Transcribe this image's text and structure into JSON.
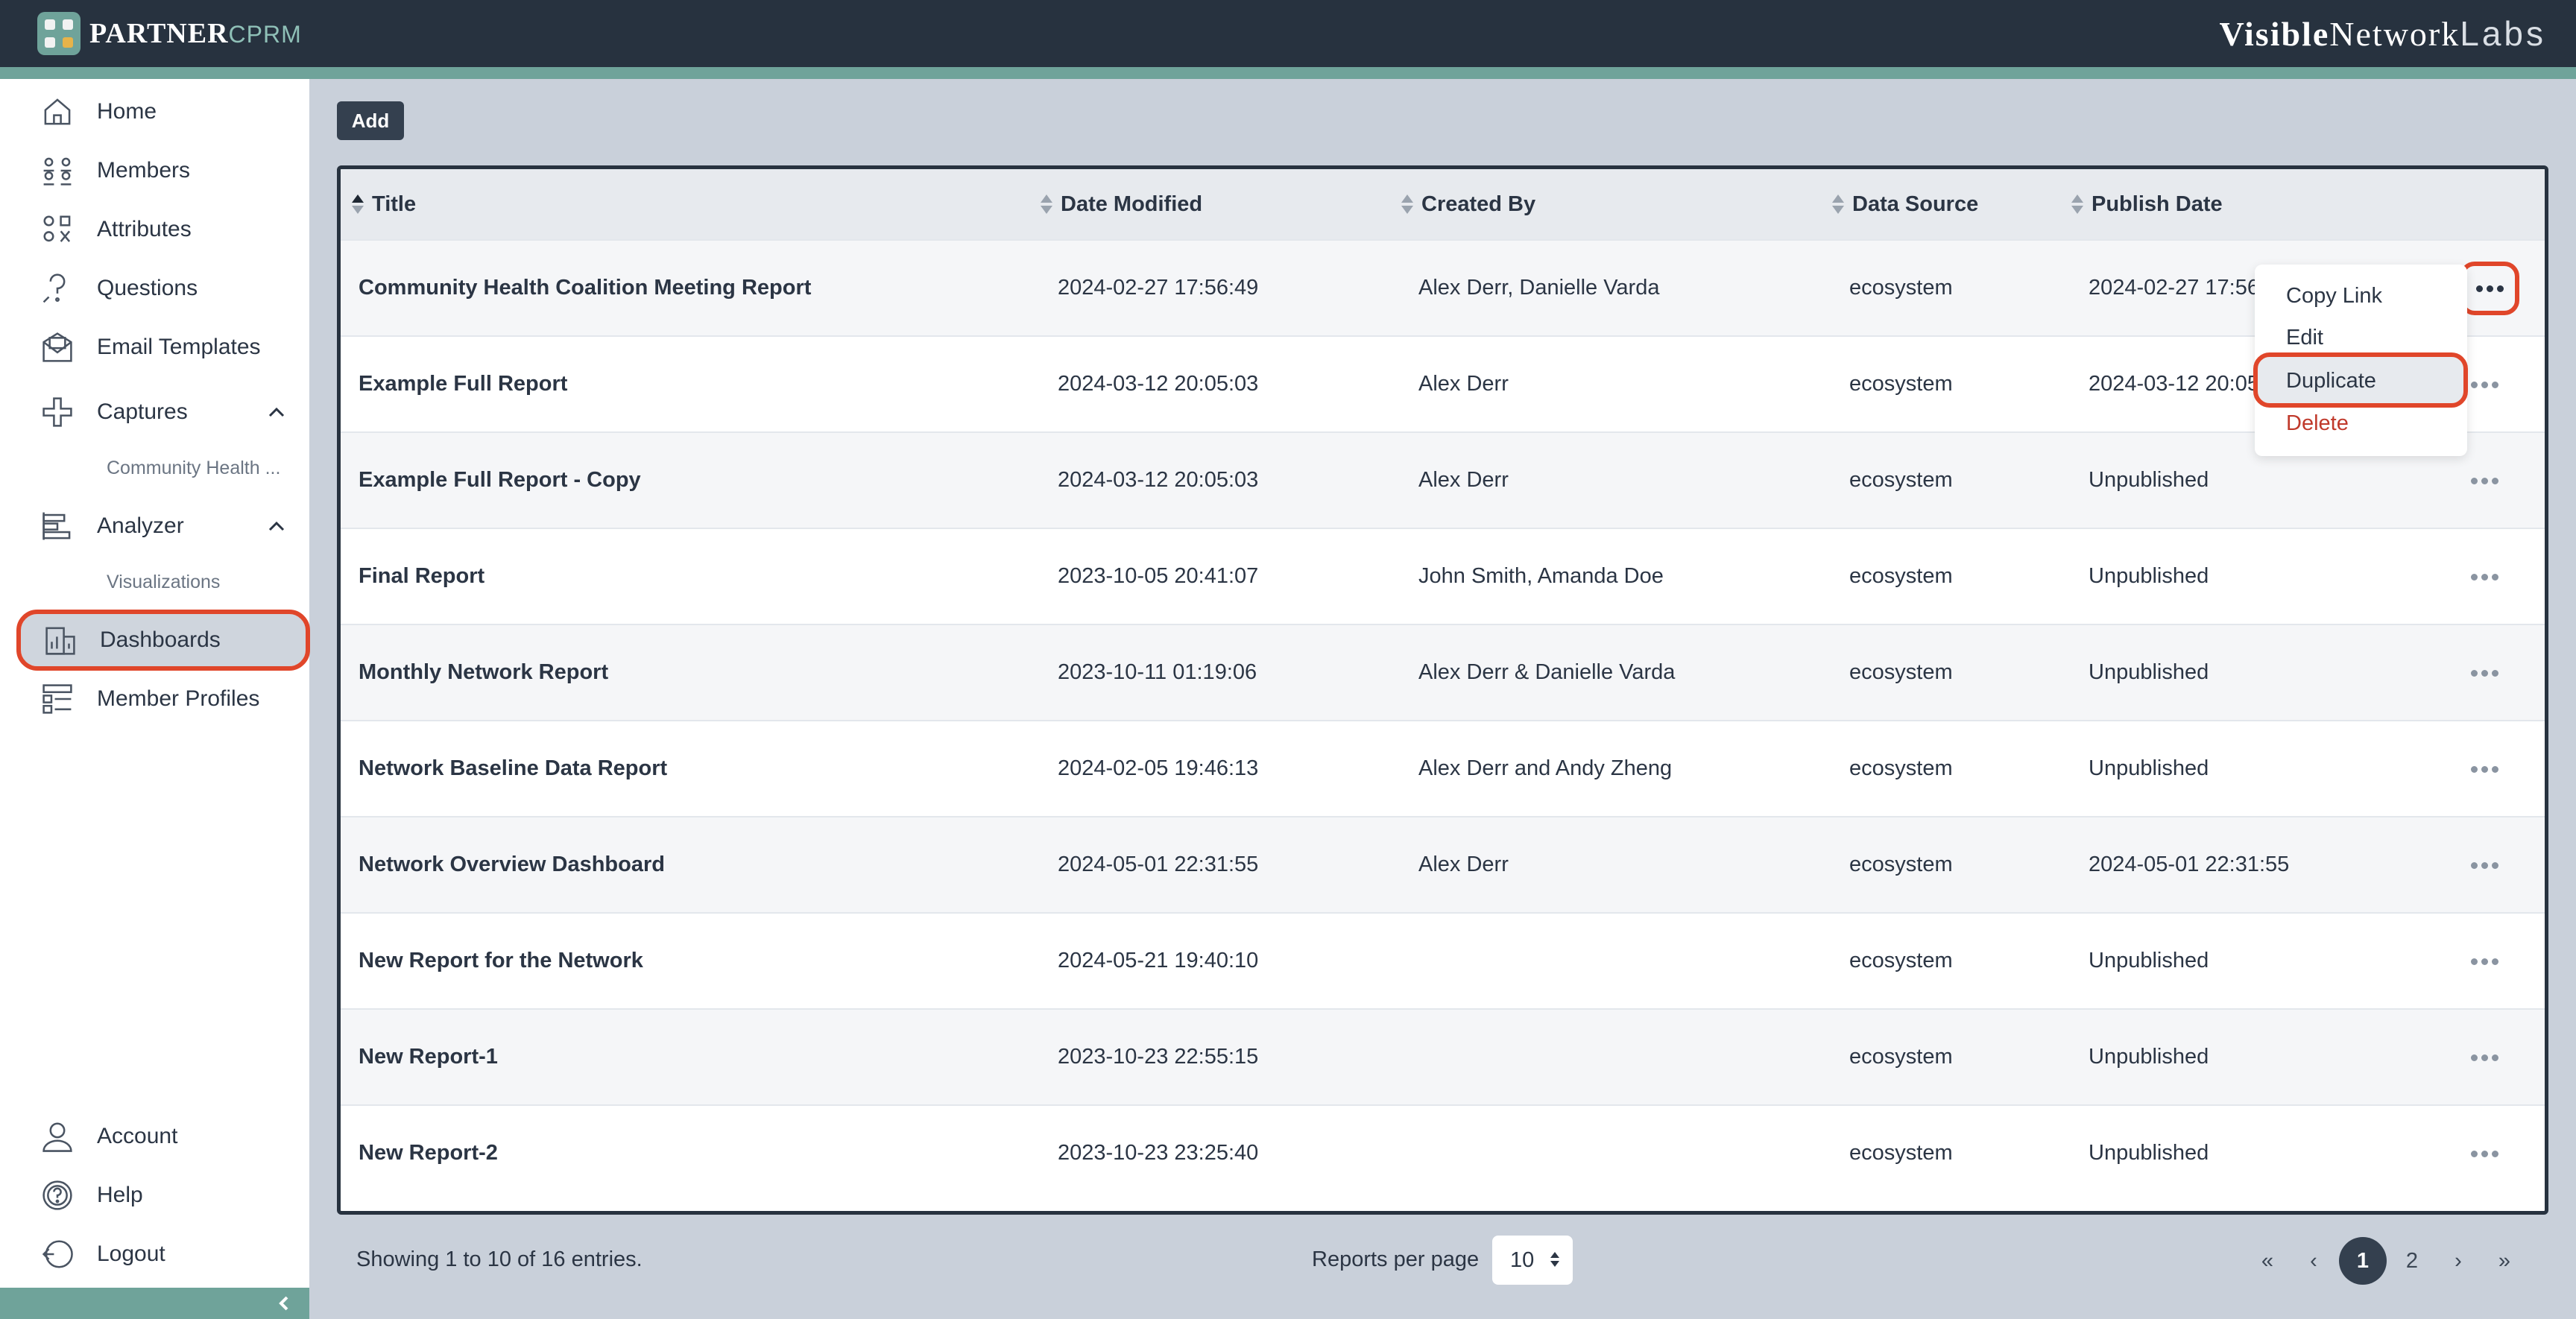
{
  "header": {
    "logo_primary": "PARTNER",
    "logo_secondary": "CPRM",
    "brand_part1": "Visible",
    "brand_part2": "Network",
    "brand_part3": "Labs"
  },
  "sidebar": {
    "items": [
      {
        "label": "Home",
        "icon": "home-icon"
      },
      {
        "label": "Members",
        "icon": "members-icon"
      },
      {
        "label": "Attributes",
        "icon": "attributes-icon"
      },
      {
        "label": "Questions",
        "icon": "questions-icon"
      },
      {
        "label": "Email Templates",
        "icon": "email-icon"
      },
      {
        "label": "Captures",
        "icon": "captures-icon"
      },
      {
        "label": "Analyzer",
        "icon": "analyzer-icon"
      },
      {
        "label": "Dashboards",
        "icon": "dashboards-icon"
      },
      {
        "label": "Member Profiles",
        "icon": "profiles-icon"
      }
    ],
    "captures_sub": "Community Health ...",
    "analyzer_sub": "Visualizations",
    "bottom": [
      {
        "label": "Account",
        "icon": "account-icon"
      },
      {
        "label": "Help",
        "icon": "help-icon"
      },
      {
        "label": "Logout",
        "icon": "logout-icon"
      }
    ]
  },
  "toolbar": {
    "add_label": "Add"
  },
  "table": {
    "columns": [
      "Title",
      "Date Modified",
      "Created By",
      "Data Source",
      "Publish Date"
    ],
    "rows": [
      {
        "title": "Community Health Coalition Meeting Report",
        "modified": "2024-02-27 17:56:49",
        "created_by": "Alex Derr, Danielle Varda",
        "source": "ecosystem",
        "publish": "2024-02-27 17:56"
      },
      {
        "title": "Example Full Report",
        "modified": "2024-03-12 20:05:03",
        "created_by": "Alex Derr",
        "source": "ecosystem",
        "publish": "2024-03-12 20:05"
      },
      {
        "title": "Example Full Report - Copy",
        "modified": "2024-03-12 20:05:03",
        "created_by": "Alex Derr",
        "source": "ecosystem",
        "publish": "Unpublished"
      },
      {
        "title": "Final Report",
        "modified": "2023-10-05 20:41:07",
        "created_by": "John Smith, Amanda Doe",
        "source": "ecosystem",
        "publish": "Unpublished"
      },
      {
        "title": "Monthly Network Report",
        "modified": "2023-10-11 01:19:06",
        "created_by": "Alex Derr & Danielle Varda",
        "source": "ecosystem",
        "publish": "Unpublished"
      },
      {
        "title": "Network Baseline Data Report",
        "modified": "2024-02-05 19:46:13",
        "created_by": "Alex Derr and Andy Zheng",
        "source": "ecosystem",
        "publish": "Unpublished"
      },
      {
        "title": "Network Overview Dashboard",
        "modified": "2024-05-01 22:31:55",
        "created_by": "Alex Derr",
        "source": "ecosystem",
        "publish": "2024-05-01 22:31:55"
      },
      {
        "title": "New Report for the Network",
        "modified": "2024-05-21 19:40:10",
        "created_by": "",
        "source": "ecosystem",
        "publish": "Unpublished"
      },
      {
        "title": "New Report-1",
        "modified": "2023-10-23 22:55:15",
        "created_by": "",
        "source": "ecosystem",
        "publish": "Unpublished"
      },
      {
        "title": "New Report-2",
        "modified": "2023-10-23 23:25:40",
        "created_by": "",
        "source": "ecosystem",
        "publish": "Unpublished"
      }
    ]
  },
  "menu": {
    "copy_link": "Copy Link",
    "edit": "Edit",
    "duplicate": "Duplicate",
    "delete": "Delete"
  },
  "footer": {
    "showing": "Showing 1 to 10 of 16 entries.",
    "per_page_label": "Reports per page",
    "per_page_value": "10",
    "pager": {
      "first": "«",
      "prev": "‹",
      "page1": "1",
      "page2": "2",
      "next": "›",
      "last": "»"
    }
  },
  "colors": {
    "header": "#27323f",
    "accent": "#6fa39a",
    "highlight": "#e0462a",
    "danger": "#c0392b"
  }
}
